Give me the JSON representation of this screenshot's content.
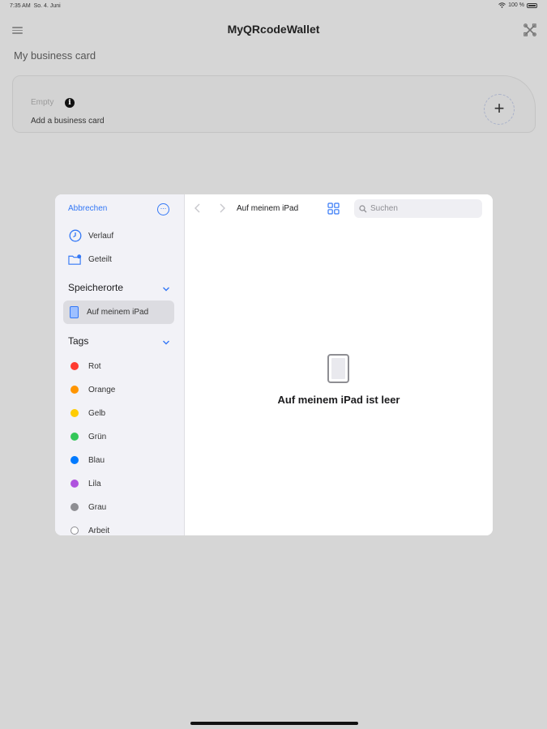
{
  "status_bar": {
    "time": "7:35 AM",
    "date": "So. 4. Juni",
    "battery": "100 %"
  },
  "header": {
    "title": "MyQRcodeWallet",
    "menu_icon": "hamburger-icon",
    "tools_icon": "tools-icon"
  },
  "section": {
    "title": "My business card"
  },
  "card": {
    "empty_label": "Empty",
    "info_icon": "info-icon",
    "add_label": "Add a business card",
    "add_button": "+"
  },
  "picker": {
    "cancel": "Abbrechen",
    "more_icon": "ellipsis-circle-icon",
    "recent": "Verlauf",
    "shared": "Geteilt",
    "locations_header": "Speicherorte",
    "location_item": "Auf meinem iPad",
    "tags_header": "Tags",
    "tags": [
      {
        "label": "Rot",
        "color": "#ff3b30"
      },
      {
        "label": "Orange",
        "color": "#ff9500"
      },
      {
        "label": "Gelb",
        "color": "#ffcc00"
      },
      {
        "label": "Grün",
        "color": "#34c759"
      },
      {
        "label": "Blau",
        "color": "#007aff"
      },
      {
        "label": "Lila",
        "color": "#af52de"
      },
      {
        "label": "Grau",
        "color": "#8e8e93"
      },
      {
        "label": "Arbeit",
        "color": "#ffffff"
      }
    ],
    "path_title": "Auf meinem iPad",
    "search_placeholder": "Suchen",
    "empty_message": "Auf meinem iPad ist leer"
  },
  "colors": {
    "accent": "#3478f6",
    "overlay_background": "#d6d6d6"
  }
}
